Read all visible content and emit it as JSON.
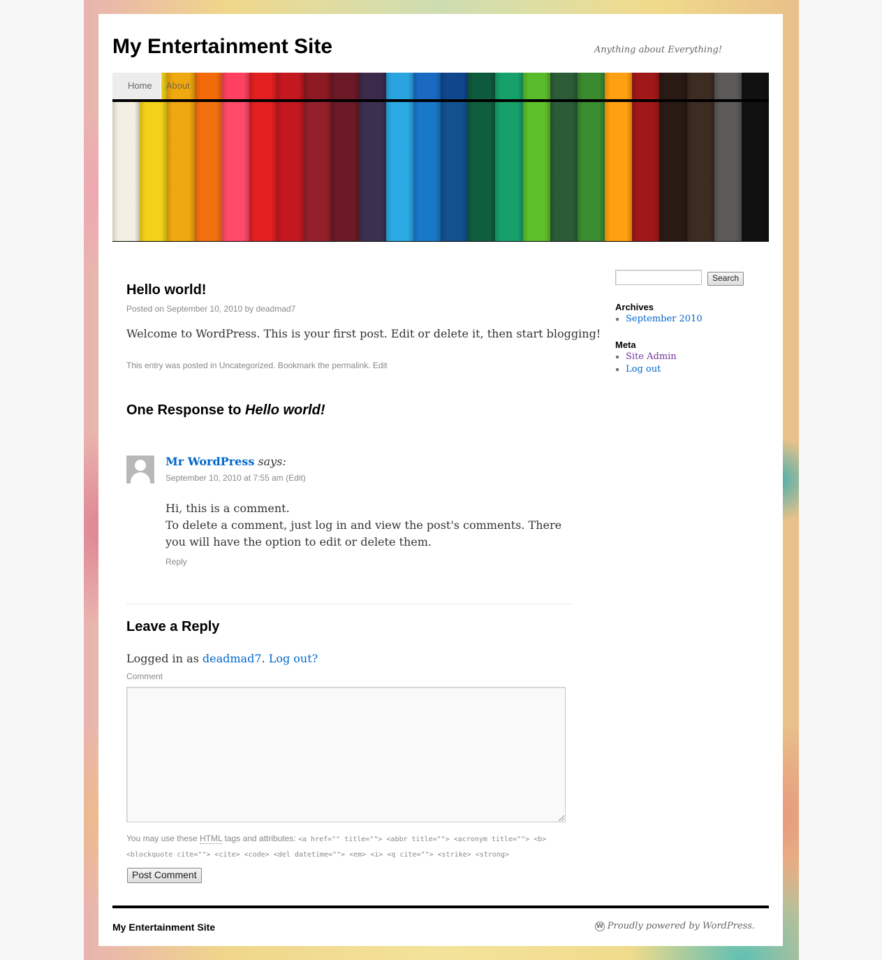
{
  "site": {
    "title": "My Entertainment Site",
    "description": "Anything about Everything!"
  },
  "nav": {
    "items": [
      {
        "label": "Home"
      },
      {
        "label": "About"
      }
    ]
  },
  "header": {
    "top_stripes": [
      "#e9e4dc",
      "#f3d11a",
      "#f0a810",
      "#f26a0a",
      "#ff4060",
      "#e22020",
      "#c41820",
      "#8e1a24",
      "#6c1a28",
      "#3c2a4a",
      "#2aa4e0",
      "#1a6ac4",
      "#10468c",
      "#0e5a3c",
      "#16a06a",
      "#5abc2a",
      "#2c5c38",
      "#3a8a30",
      "#ffa010",
      "#a01818",
      "#2a1a14",
      "#3c2c22",
      "#5c5a58",
      "#111111"
    ],
    "main_stripes": [
      "#f3efe2",
      "#f3d11a",
      "#f0a810",
      "#f27010",
      "#ff4a6a",
      "#e22020",
      "#c41820",
      "#94202c",
      "#6c1a28",
      "#3c3050",
      "#2aaae4",
      "#1a78c8",
      "#12508e",
      "#0f5f3e",
      "#18a06c",
      "#5ec02a",
      "#2a5c36",
      "#3a8c30",
      "#ffa010",
      "#a01818",
      "#2a1a14",
      "#3c2c22",
      "#5c5a58",
      "#111111"
    ]
  },
  "post": {
    "title": "Hello world!",
    "meta": {
      "posted_on": "Posted on",
      "date": "September 10, 2010",
      "by": "by",
      "author": "deadmad7"
    },
    "body": "Welcome to WordPress. This is your first post. Edit or delete it, then start blogging!",
    "utility": {
      "prefix": "This entry was posted in",
      "category": "Uncategorized",
      "sep1": ". Bookmark the",
      "permalink": "permalink",
      "sep2": ".",
      "edit": "Edit"
    }
  },
  "comments": {
    "title_prefix": "One Response to",
    "title_post": "Hello world!",
    "items": [
      {
        "author": "Mr WordPress",
        "says": "says:",
        "date": "September 10, 2010 at 7:55 am",
        "edit": "(Edit)",
        "line1": "Hi, this is a comment.",
        "line2": "To delete a comment, just log in and view the post's comments. There you will have the option to edit or delete them.",
        "reply": "Reply"
      }
    ]
  },
  "reply_form": {
    "title": "Leave a Reply",
    "logged_in_prefix": "Logged in as",
    "user": "deadmad7",
    "sep": ".",
    "logout": "Log out?",
    "comment_label": "Comment",
    "allowed_prefix": "You may use these",
    "allowed_abbr": "HTML",
    "allowed_middle": "tags and attributes:",
    "allowed_tags": "<a href=\"\" title=\"\"> <abbr title=\"\"> <acronym title=\"\"> <b> <blockquote cite=\"\"> <cite> <code> <del datetime=\"\"> <em> <i> <q cite=\"\"> <strike> <strong>",
    "submit": "Post Comment"
  },
  "sidebar": {
    "search_button": "Search",
    "search_value": "",
    "archives_title": "Archives",
    "archives": [
      {
        "label": "September 2010"
      }
    ],
    "meta_title": "Meta",
    "meta": [
      {
        "label": "Site Admin"
      },
      {
        "label": "Log out"
      }
    ]
  },
  "footer": {
    "site_title": "My Entertainment Site",
    "powered": "Proudly powered by WordPress."
  }
}
